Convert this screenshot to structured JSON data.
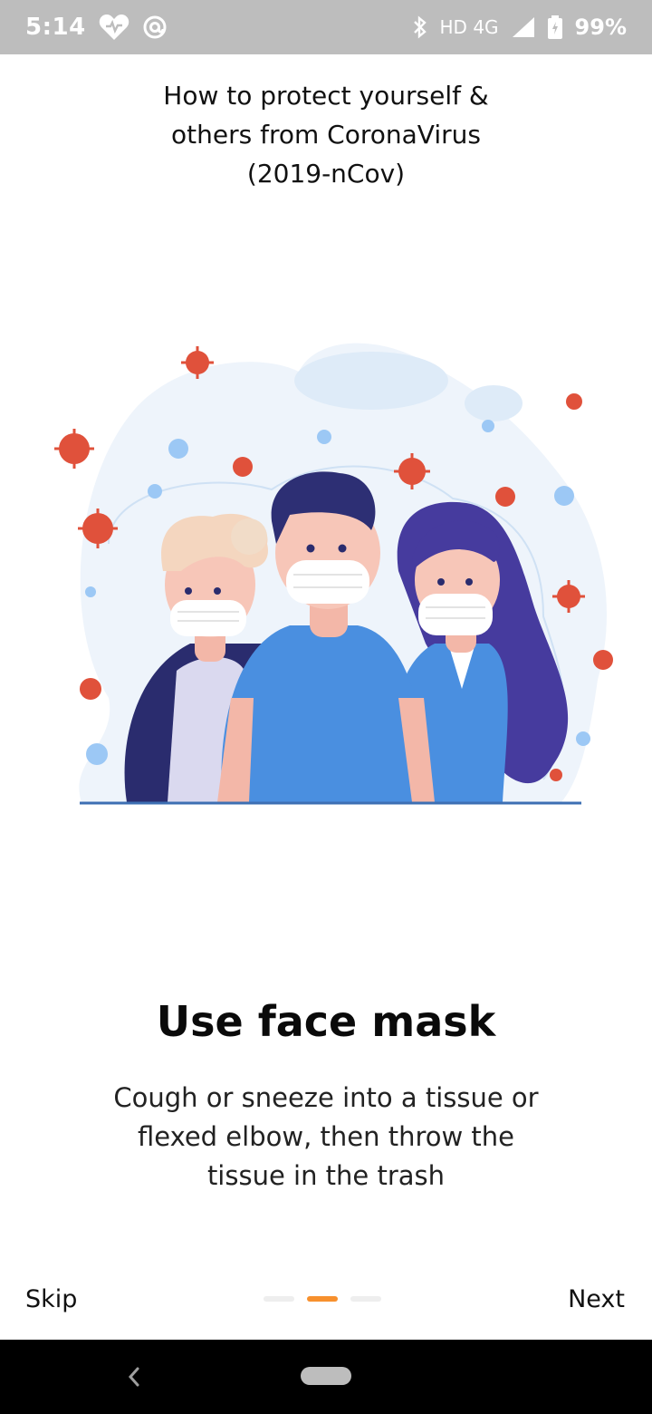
{
  "status_bar": {
    "time": "5:14",
    "network": "HD 4G",
    "battery": "99%",
    "icons": [
      "heart-icon",
      "at-icon",
      "bluetooth-icon",
      "signal-icon",
      "battery-icon"
    ]
  },
  "header": {
    "title": "How to protect yourself &\nothers from CoronaVirus\n(2019-nCov)"
  },
  "slide": {
    "heading": "Use face mask",
    "body": "Cough or sneeze into a tissue or\nflexed elbow, then throw the\ntissue in the trash",
    "page_count": 3,
    "current_page": 2
  },
  "footer": {
    "skip_label": "Skip",
    "next_label": "Next"
  },
  "colors": {
    "status_bar": "#bdbdbd",
    "accent": "#f7902d",
    "virus_red": "#e0513b",
    "virus_blue": "#9cc8f5",
    "shirt_blue": "#4a8fe0",
    "hair_dark": "#2d2f74",
    "hair_purple": "#463b9e"
  }
}
